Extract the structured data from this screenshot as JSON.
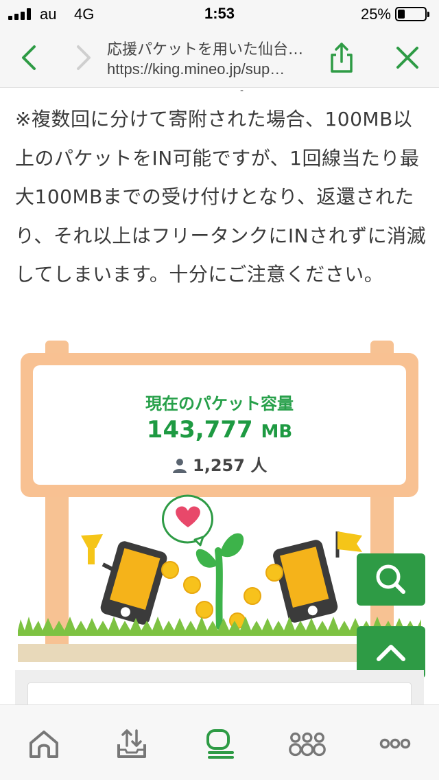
{
  "status_bar": {
    "carrier": "au",
    "network": "4G",
    "time": "1:53",
    "battery_percent_text": "25%",
    "battery_level": 0.25
  },
  "browser": {
    "page_title": "応援パケットを用いた仙台…",
    "url": "https://king.mineo.jp/sup…",
    "accent_color": "#2e9b45"
  },
  "article": {
    "dash": "-",
    "paragraph": "※複数回に分けて寄附された場合、100MB以上のパケットをIN可能ですが、1回線当たり最大100MBまでの受け付けとなり、返還されたり、それ以上はフリータンクにINされずに消滅してしまいます。十分にご注意ください。"
  },
  "packet_board": {
    "label": "現在のパケット容量",
    "value": "143,777",
    "unit": "MB",
    "users_count": "1,257",
    "users_suffix": "人"
  },
  "bottom_tabs": [
    {
      "icon": "home-icon"
    },
    {
      "icon": "upload-tray-icon"
    },
    {
      "icon": "chat-bubble-icon",
      "active": true
    },
    {
      "icon": "community-icon"
    },
    {
      "icon": "more-icon"
    }
  ]
}
